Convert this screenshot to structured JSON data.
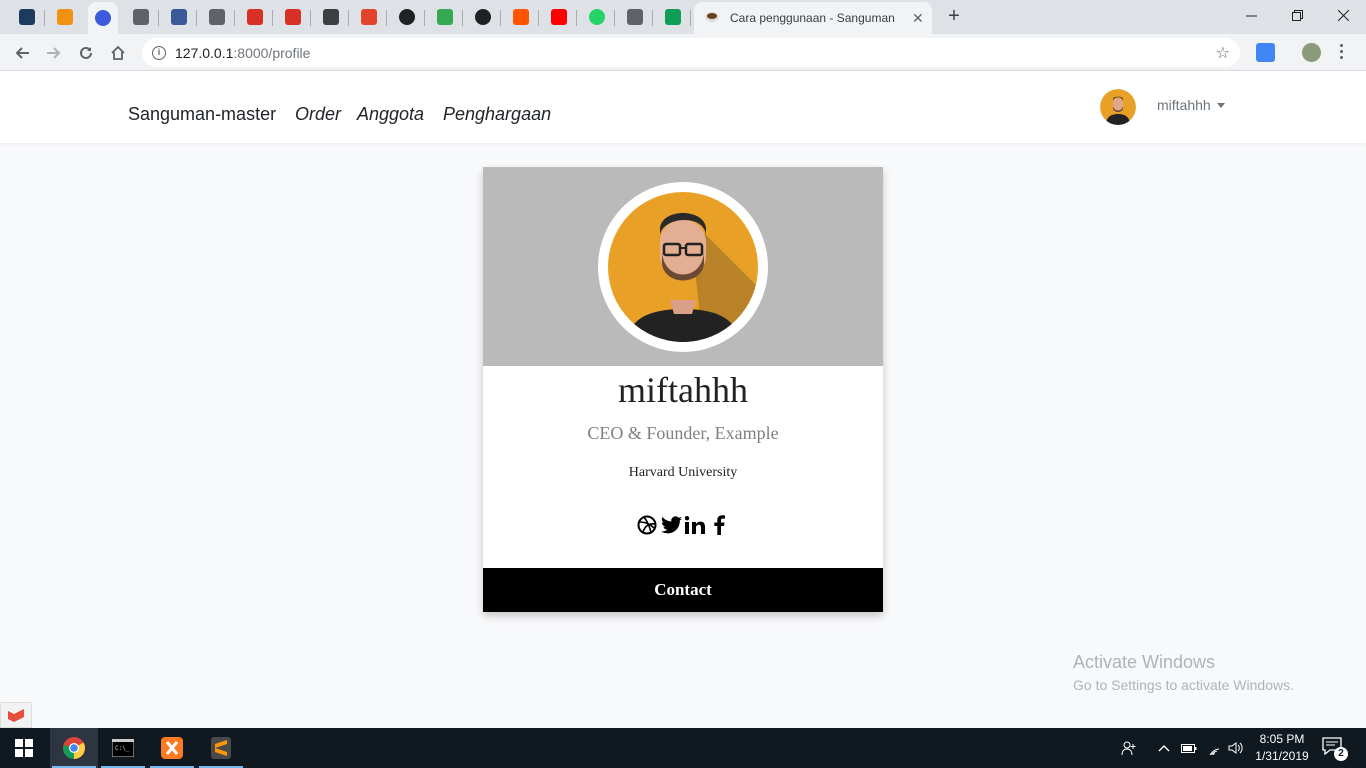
{
  "browser": {
    "pinned_tabs": [
      {
        "icon": "mail-icon",
        "color": "#1e3a5f"
      },
      {
        "icon": "phpmyadmin-icon",
        "color": "#f29111"
      },
      {
        "icon": "circle-app-icon",
        "color": "#3b5bdb"
      },
      {
        "icon": "blank-page-icon",
        "color": "#5f6368"
      },
      {
        "icon": "facebook-icon",
        "color": "#3b5998"
      },
      {
        "icon": "send-icon",
        "color": "#5f6368"
      },
      {
        "icon": "gmail-icon",
        "color": "#d93025"
      },
      {
        "icon": "gmail-icon",
        "color": "#d93025"
      },
      {
        "icon": "stripes-icon",
        "color": "#3c4043"
      },
      {
        "icon": "gitlab-icon",
        "color": "#e24329"
      },
      {
        "icon": "github-icon",
        "color": "#202124"
      },
      {
        "icon": "mountain-icon",
        "color": "#34a853"
      },
      {
        "icon": "check-circle-icon",
        "color": "#202124"
      },
      {
        "icon": "soundcloud-icon",
        "color": "#ff5500"
      },
      {
        "icon": "youtube-icon",
        "color": "#ff0000"
      },
      {
        "icon": "whatsapp-icon",
        "color": "#25d366"
      },
      {
        "icon": "blank-page-icon",
        "color": "#5f6368"
      },
      {
        "icon": "sheets-icon",
        "color": "#0f9d58"
      }
    ],
    "active_tab": {
      "title": "Cara penggunaan - Sanguman",
      "icon": "coffee-cup-icon"
    },
    "new_tab_label": "+",
    "url_host": "127.0.0.1",
    "url_path": ":8000/profile"
  },
  "navbar": {
    "brand": "Sanguman-master",
    "links": [
      "Order",
      "Anggota",
      "Penghargaan"
    ],
    "username": "miftahhh"
  },
  "profile": {
    "name": "miftahhh",
    "title": "CEO & Founder, Example",
    "organization": "Harvard University",
    "social_icons": [
      "dribbble-icon",
      "twitter-icon",
      "linkedin-icon",
      "facebook-icon"
    ],
    "contact_label": "Contact"
  },
  "watermark": {
    "line1": "Activate Windows",
    "line2": "Go to Settings to activate Windows."
  },
  "taskbar": {
    "apps": [
      "windows-start-icon",
      "chrome-icon",
      "terminal-icon",
      "xampp-icon",
      "sublime-text-icon"
    ],
    "time": "8:05 PM",
    "date": "1/31/2019",
    "notification_count": "2"
  },
  "colors": {
    "card_header_bg": "#bababa",
    "page_bg": "#f8f9fa",
    "avatar_orange": "#e8a126",
    "contact_bg": "#000000",
    "taskbar_bg": "#101820"
  }
}
